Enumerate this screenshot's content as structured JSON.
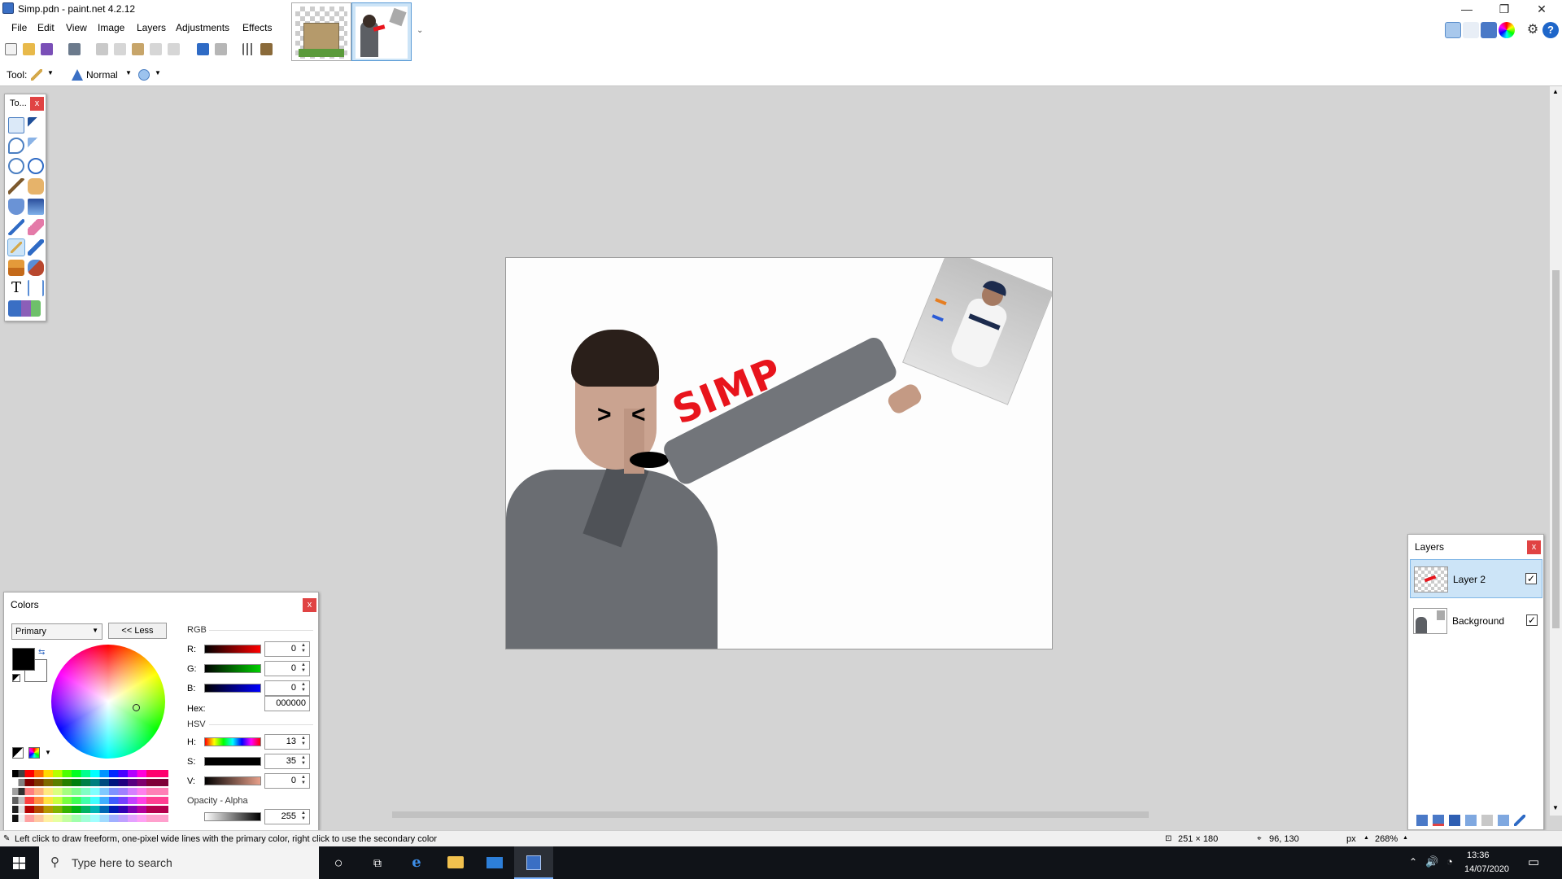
{
  "window": {
    "title": "Simp.pdn - paint.net 4.2.12",
    "minimize": "—",
    "restore": "❐",
    "close": "✕"
  },
  "menu": [
    "File",
    "Edit",
    "View",
    "Image",
    "Layers",
    "Adjustments",
    "Effects"
  ],
  "toolbar2": {
    "tool_label": "Tool:",
    "blend_mode": "Normal"
  },
  "tools_panel": {
    "title": "To...",
    "close": "x"
  },
  "canvas": {
    "simp_text": "SIMP"
  },
  "colors_panel": {
    "title": "Colors",
    "close": "x",
    "mode_select": "Primary",
    "less_button": "<< Less",
    "rgb_label": "RGB",
    "hsv_label": "HSV",
    "r_label": "R:",
    "g_label": "G:",
    "b_label": "B:",
    "h_label": "H:",
    "s_label": "S:",
    "v_label": "V:",
    "hex_label": "Hex:",
    "opacity_label": "Opacity - Alpha",
    "r": "0",
    "g": "0",
    "b": "0",
    "hex": "000000",
    "h": "13",
    "s": "35",
    "v": "0",
    "alpha": "255"
  },
  "layers_panel": {
    "title": "Layers",
    "close": "x",
    "layers": [
      {
        "name": "Layer 2",
        "visible": "✓"
      },
      {
        "name": "Background",
        "visible": "✓"
      }
    ]
  },
  "status": {
    "hint": "Left click to draw freeform, one-pixel wide lines with the primary color, right click to use the secondary color",
    "image_size": "251 × 180",
    "cursor_pos": "96, 130",
    "units": "px",
    "zoom": "268%"
  },
  "taskbar": {
    "search_placeholder": "Type here to search",
    "time": "13:36",
    "date": "14/07/2020"
  },
  "colors": {
    "accent": "#0078d7",
    "close_red": "#e04343",
    "simp_red": "#e8141c"
  }
}
